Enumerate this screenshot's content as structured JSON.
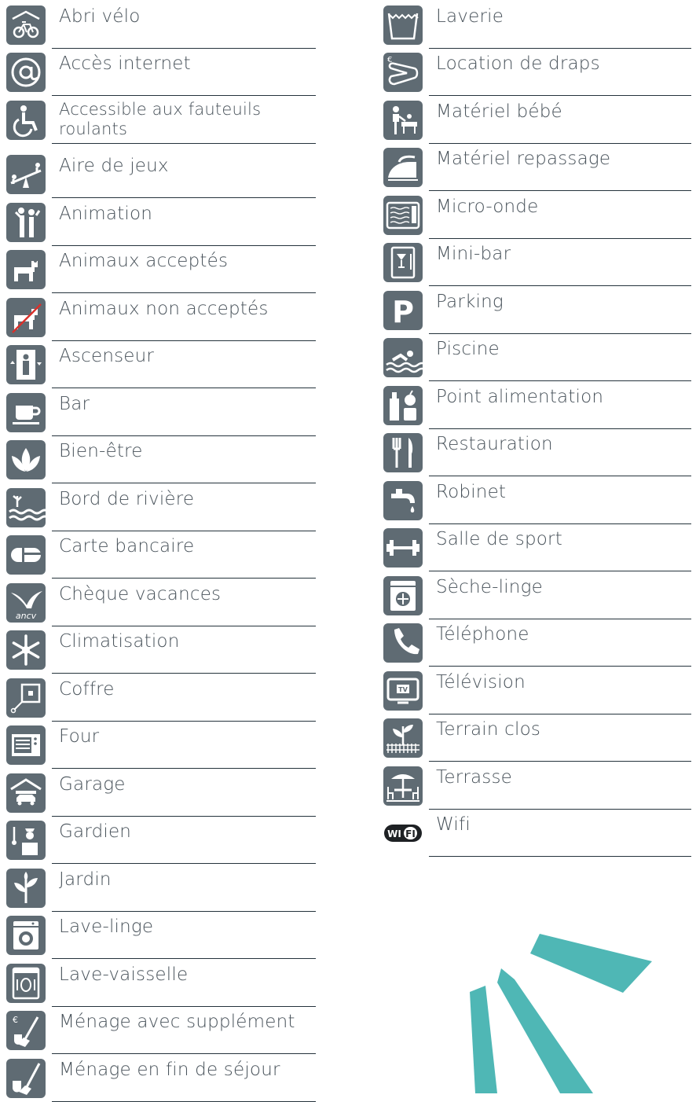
{
  "left_column": [
    {
      "label": "Abri vélo",
      "icon": "bike-shelter-icon"
    },
    {
      "label": "Accès internet",
      "icon": "at-sign-icon"
    },
    {
      "label": "Accessible aux fauteuils roulants",
      "icon": "wheelchair-icon"
    },
    {
      "label": "Aire de jeux",
      "icon": "playground-icon"
    },
    {
      "label": "Animation",
      "icon": "animation-icon"
    },
    {
      "label": "Animaux acceptés",
      "icon": "dog-icon"
    },
    {
      "label": "Animaux non acceptés",
      "icon": "no-dog-icon"
    },
    {
      "label": "Ascenseur",
      "icon": "elevator-icon"
    },
    {
      "label": "Bar",
      "icon": "coffee-cup-icon"
    },
    {
      "label": "Bien-être",
      "icon": "lotus-icon"
    },
    {
      "label": "Bord de rivière",
      "icon": "riverside-icon"
    },
    {
      "label": "Carte bancaire",
      "icon": "credit-card-icon"
    },
    {
      "label": "Chèque vacances",
      "icon": "ancv-icon"
    },
    {
      "label": "Climatisation",
      "icon": "snowflake-icon"
    },
    {
      "label": "Coffre",
      "icon": "safe-icon"
    },
    {
      "label": "Four",
      "icon": "oven-icon"
    },
    {
      "label": "Garage",
      "icon": "garage-icon"
    },
    {
      "label": "Gardien",
      "icon": "caretaker-icon"
    },
    {
      "label": "Jardin",
      "icon": "plant-icon"
    },
    {
      "label": "Lave-linge",
      "icon": "washing-machine-icon"
    },
    {
      "label": "Lave-vaisselle",
      "icon": "dishwasher-icon"
    },
    {
      "label": "Ménage avec supplément",
      "icon": "broom-euro-icon"
    },
    {
      "label": "Ménage en fin de séjour",
      "icon": "broom-icon"
    }
  ],
  "right_column": [
    {
      "label": "Laverie",
      "icon": "wash-basin-icon"
    },
    {
      "label": "Location de draps",
      "icon": "sheets-euro-icon"
    },
    {
      "label": "Matériel bébé",
      "icon": "baby-changing-icon"
    },
    {
      "label": "Matériel repassage",
      "icon": "iron-icon"
    },
    {
      "label": "Micro-onde",
      "icon": "microwave-icon"
    },
    {
      "label": "Mini-bar",
      "icon": "minibar-icon"
    },
    {
      "label": "Parking",
      "icon": "parking-icon"
    },
    {
      "label": "Piscine",
      "icon": "swimming-pool-icon"
    },
    {
      "label": "Point alimentation",
      "icon": "groceries-icon"
    },
    {
      "label": "Restauration",
      "icon": "fork-knife-icon"
    },
    {
      "label": "Robinet",
      "icon": "faucet-icon"
    },
    {
      "label": "Salle de sport",
      "icon": "dumbbell-icon"
    },
    {
      "label": "Sèche-linge",
      "icon": "dryer-icon"
    },
    {
      "label": "Téléphone",
      "icon": "phone-icon"
    },
    {
      "label": "Télévision",
      "icon": "tv-icon"
    },
    {
      "label": "Terrain clos",
      "icon": "fenced-garden-icon"
    },
    {
      "label": "Terrasse",
      "icon": "terrace-icon"
    },
    {
      "label": "Wifi",
      "icon": "wifi-icon"
    }
  ],
  "icon_texts": {
    "ancv": "ancv",
    "parking": "P",
    "tv": "TV",
    "wifi_left": "WI",
    "wifi_right": "FI",
    "euro": "€"
  },
  "colors": {
    "icon_background": "#5f6b73",
    "text": "#48525a",
    "rule": "#25333c",
    "accent_teal": "#4fb7b5",
    "no_pets_slash": "#d9312b"
  }
}
